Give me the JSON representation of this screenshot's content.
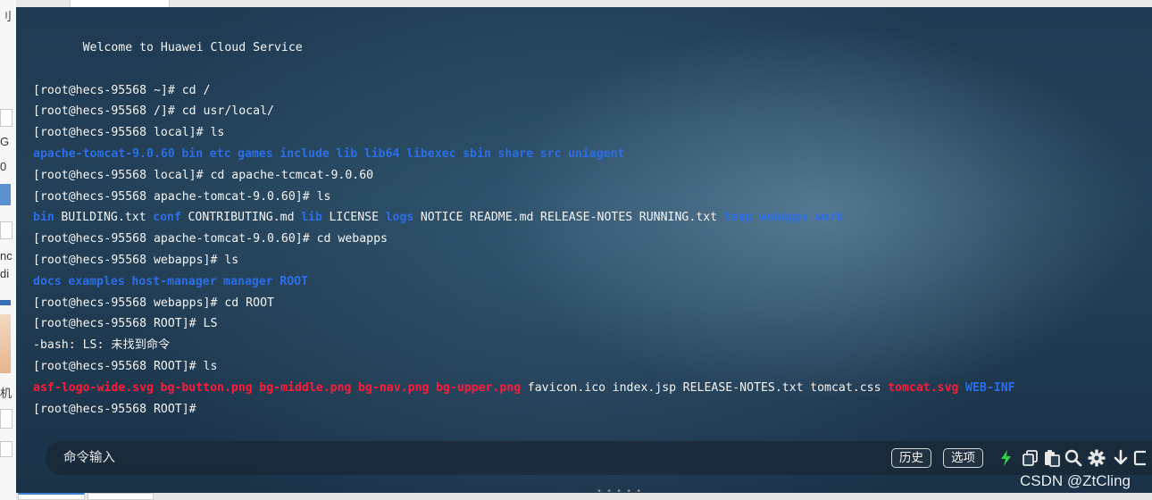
{
  "left_panel": {
    "fragments": [
      "刂",
      "G",
      "0",
      "nc",
      "di",
      "机"
    ]
  },
  "terminal": {
    "lines": [
      {
        "tokens": [
          {
            "text": "       Welcome to Huawei Cloud Service",
            "style": "plain"
          }
        ]
      },
      {
        "tokens": []
      },
      {
        "tokens": [
          {
            "text": "[root@hecs-95568 ~]# cd /",
            "style": "plain"
          }
        ]
      },
      {
        "tokens": [
          {
            "text": "[root@hecs-95568 /]# cd usr/local/",
            "style": "plain"
          }
        ]
      },
      {
        "tokens": [
          {
            "text": "[root@hecs-95568 local]# ls",
            "style": "plain"
          }
        ]
      },
      {
        "tokens": [
          {
            "text": "apache-tomcat-9.0.60",
            "style": "dir"
          },
          {
            "text": "bin",
            "style": "dir"
          },
          {
            "text": "etc",
            "style": "dir"
          },
          {
            "text": "games",
            "style": "dir"
          },
          {
            "text": "include",
            "style": "dir"
          },
          {
            "text": "lib",
            "style": "dir"
          },
          {
            "text": "lib64",
            "style": "dir"
          },
          {
            "text": "libexec",
            "style": "dir"
          },
          {
            "text": "sbin",
            "style": "dir"
          },
          {
            "text": "share",
            "style": "dir"
          },
          {
            "text": "src",
            "style": "dir"
          },
          {
            "text": "uniagent",
            "style": "dir"
          }
        ]
      },
      {
        "tokens": [
          {
            "text": "[root@hecs-95568 local]# cd apache-tcmcat-9.0.60",
            "style": "plain"
          }
        ]
      },
      {
        "tokens": [
          {
            "text": "[root@hecs-95568 apache-tomcat-9.0.60]# ls",
            "style": "plain"
          }
        ]
      },
      {
        "tokens": [
          {
            "text": "bin",
            "style": "dir"
          },
          {
            "text": "BUILDING.txt",
            "style": "plain"
          },
          {
            "text": "conf",
            "style": "dir"
          },
          {
            "text": "CONTRIBUTING.md",
            "style": "plain"
          },
          {
            "text": "lib",
            "style": "dir"
          },
          {
            "text": "LICENSE",
            "style": "plain"
          },
          {
            "text": "logs",
            "style": "dir"
          },
          {
            "text": "NOTICE",
            "style": "plain"
          },
          {
            "text": "README.md",
            "style": "plain"
          },
          {
            "text": "RELEASE-NOTES",
            "style": "plain"
          },
          {
            "text": "RUNNING.txt",
            "style": "plain"
          },
          {
            "text": "temp",
            "style": "dir"
          },
          {
            "text": "webapps",
            "style": "dir"
          },
          {
            "text": "work",
            "style": "dir"
          }
        ]
      },
      {
        "tokens": [
          {
            "text": "[root@hecs-95568 apache-tomcat-9.0.60]# cd webapps",
            "style": "plain"
          }
        ]
      },
      {
        "tokens": [
          {
            "text": "[root@hecs-95568 webapps]# ls",
            "style": "plain"
          }
        ]
      },
      {
        "tokens": [
          {
            "text": "docs",
            "style": "dir"
          },
          {
            "text": "examples",
            "style": "dir"
          },
          {
            "text": "host-manager",
            "style": "dir"
          },
          {
            "text": "manager",
            "style": "dir"
          },
          {
            "text": "ROOT",
            "style": "dir"
          }
        ]
      },
      {
        "tokens": [
          {
            "text": "[root@hecs-95568 webapps]# cd ROOT",
            "style": "plain"
          }
        ]
      },
      {
        "tokens": [
          {
            "text": "[root@hecs-95568 ROOT]# LS",
            "style": "plain"
          }
        ]
      },
      {
        "tokens": [
          {
            "text": "-bash: LS: 未找到命令",
            "style": "plain"
          }
        ]
      },
      {
        "tokens": [
          {
            "text": "[root@hecs-95568 ROOT]# ls",
            "style": "plain"
          }
        ]
      },
      {
        "tokens": [
          {
            "text": "asf-logo-wide.svg",
            "style": "red"
          },
          {
            "text": "bg-button.png",
            "style": "red"
          },
          {
            "text": "bg-middle.png",
            "style": "red"
          },
          {
            "text": "bg-nav.png",
            "style": "red"
          },
          {
            "text": "bg-upper.png",
            "style": "red"
          },
          {
            "text": "favicon.ico",
            "style": "plain"
          },
          {
            "text": "index.jsp",
            "style": "plain"
          },
          {
            "text": "RELEASE-NOTES.txt",
            "style": "plain"
          },
          {
            "text": "tomcat.css",
            "style": "plain"
          },
          {
            "text": "tomcat.svg",
            "style": "red"
          },
          {
            "text": "WEB-INF",
            "style": "dir"
          }
        ]
      },
      {
        "tokens": [
          {
            "text": "[root@hecs-95568 ROOT]#",
            "style": "plain"
          }
        ]
      }
    ]
  },
  "command_bar": {
    "placeholder": "命令输入",
    "history_label": "历史",
    "options_label": "选项",
    "icons": [
      "lightning-icon",
      "copy-icon",
      "paste-icon",
      "search-icon",
      "gear-icon",
      "download-icon",
      "window-icon"
    ]
  },
  "watermark": "CSDN @ZtCling",
  "colors": {
    "directory": "#2c6ee6",
    "highlight_file": "#ff1a3a",
    "text": "#f4f4f4",
    "lightning": "#2fd14a"
  }
}
